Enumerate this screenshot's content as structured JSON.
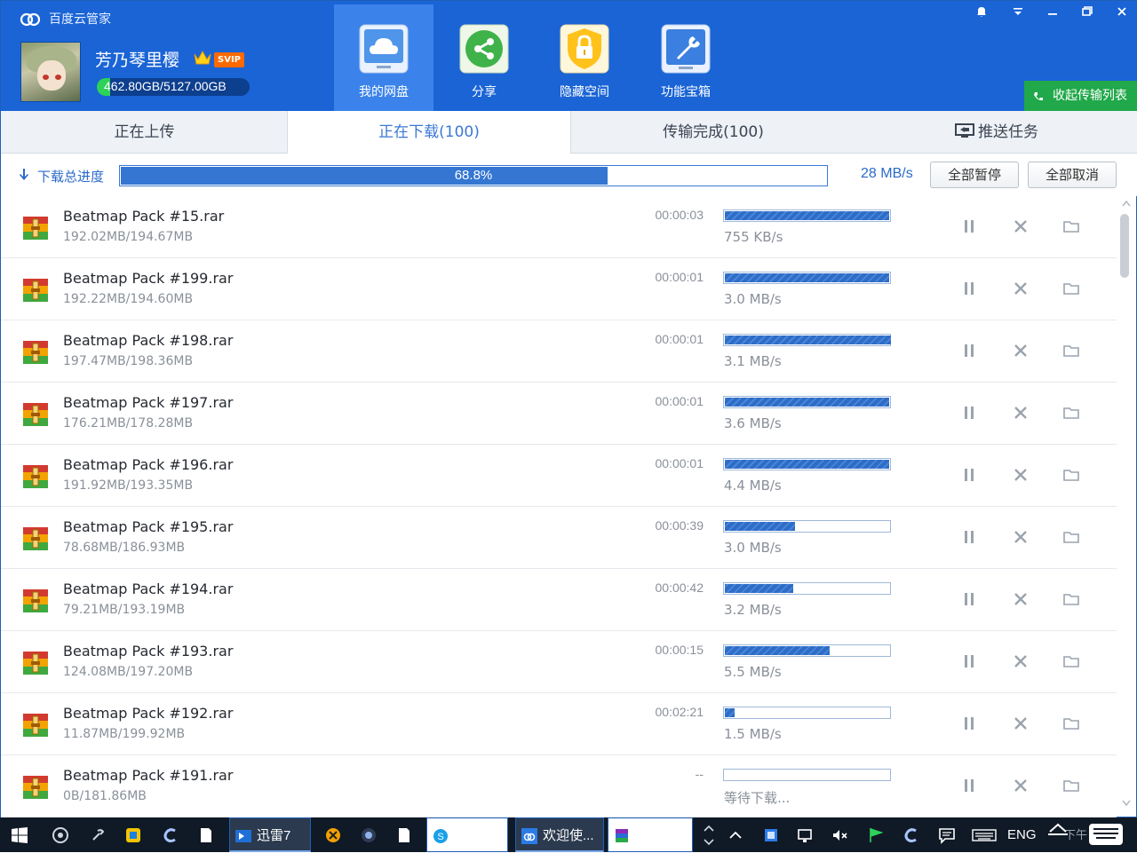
{
  "app": {
    "title": "百度云管家"
  },
  "user": {
    "name": "芳乃琴里樱",
    "badge": "SVIP",
    "quota_text": "462.80GB/5127.00GB",
    "quota_fraction": 0.09
  },
  "nav": [
    {
      "label": "我的网盘",
      "icon": "cloud-drive-icon",
      "active": true
    },
    {
      "label": "分享",
      "icon": "share-icon"
    },
    {
      "label": "隐藏空间",
      "icon": "lock-icon"
    },
    {
      "label": "功能宝箱",
      "icon": "toolbox-icon"
    }
  ],
  "collapse_button": "收起传输列表",
  "tabs": [
    {
      "label": "正在上传"
    },
    {
      "label": "正在下载(100)",
      "active": true
    },
    {
      "label": "传输完成(100)"
    },
    {
      "label": "推送任务"
    }
  ],
  "progress": {
    "label": "下载总进度",
    "percent_text": "68.8%",
    "fraction": 0.688,
    "speed": "28 MB/s",
    "pause_all": "全部暂停",
    "cancel_all": "全部取消"
  },
  "downloads": [
    {
      "name": "Beatmap Pack #15.rar",
      "size": "192.02MB/194.67MB",
      "eta": "00:00:03",
      "speed": "755 KB/s",
      "progress": 0.99
    },
    {
      "name": "Beatmap Pack #199.rar",
      "size": "192.22MB/194.60MB",
      "eta": "00:00:01",
      "speed": "3.0 MB/s",
      "progress": 0.99
    },
    {
      "name": "Beatmap Pack #198.rar",
      "size": "197.47MB/198.36MB",
      "eta": "00:00:01",
      "speed": "3.1 MB/s",
      "progress": 1.0
    },
    {
      "name": "Beatmap Pack #197.rar",
      "size": "176.21MB/178.28MB",
      "eta": "00:00:01",
      "speed": "3.6 MB/s",
      "progress": 0.99
    },
    {
      "name": "Beatmap Pack #196.rar",
      "size": "191.92MB/193.35MB",
      "eta": "00:00:01",
      "speed": "4.4 MB/s",
      "progress": 0.99
    },
    {
      "name": "Beatmap Pack #195.rar",
      "size": "78.68MB/186.93MB",
      "eta": "00:00:39",
      "speed": "3.0 MB/s",
      "progress": 0.42
    },
    {
      "name": "Beatmap Pack #194.rar",
      "size": "79.21MB/193.19MB",
      "eta": "00:00:42",
      "speed": "3.2 MB/s",
      "progress": 0.41
    },
    {
      "name": "Beatmap Pack #193.rar",
      "size": "124.08MB/197.20MB",
      "eta": "00:00:15",
      "speed": "5.5 MB/s",
      "progress": 0.63
    },
    {
      "name": "Beatmap Pack #192.rar",
      "size": "11.87MB/199.92MB",
      "eta": "00:02:21",
      "speed": "1.5 MB/s",
      "progress": 0.06
    },
    {
      "name": "Beatmap Pack #191.rar",
      "size": "0B/181.86MB",
      "eta": "--",
      "speed": "等待下载...",
      "progress": 0
    }
  ],
  "taskbar": {
    "apps": [
      {
        "label": "迅雷7"
      },
      {
        "label": "Skype..."
      },
      {
        "label": "欢迎使..."
      },
      {
        "label": "WinRAR"
      }
    ],
    "lang": "ENG",
    "clock_partial": "下午"
  },
  "colors": {
    "header": "#1a64d6",
    "accent": "#3476d2",
    "green": "#20a84a",
    "taskbar": "#101a26"
  }
}
